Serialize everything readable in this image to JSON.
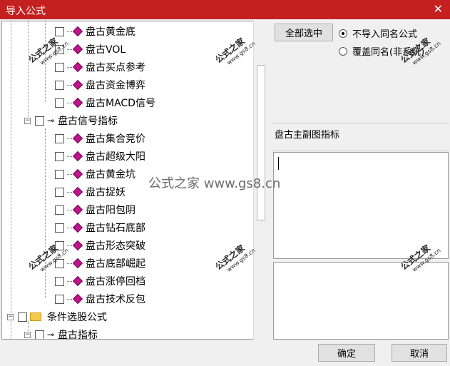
{
  "window": {
    "title": "导入公式"
  },
  "tree": {
    "items": [
      {
        "label": "盘古黄金底",
        "kind": "formula"
      },
      {
        "label": "盘古VOL",
        "kind": "formula"
      },
      {
        "label": "盘古买点参考",
        "kind": "formula"
      },
      {
        "label": "盘古资金博弈",
        "kind": "formula"
      },
      {
        "label": "盘古MACD信号",
        "kind": "formula"
      },
      {
        "label": "盘古信号指标",
        "kind": "group"
      },
      {
        "label": "盘古集合竞价",
        "kind": "formula"
      },
      {
        "label": "盘古超级大阳",
        "kind": "formula"
      },
      {
        "label": "盘古黄金坑",
        "kind": "formula"
      },
      {
        "label": "盘古捉妖",
        "kind": "formula"
      },
      {
        "label": "盘古阳包阴",
        "kind": "formula"
      },
      {
        "label": "盘古钻石底部",
        "kind": "formula"
      },
      {
        "label": "盘古形态突破",
        "kind": "formula"
      },
      {
        "label": "盘古底部崛起",
        "kind": "formula"
      },
      {
        "label": "盘古涨停回档",
        "kind": "formula"
      },
      {
        "label": "盘古技术反包",
        "kind": "formula"
      },
      {
        "label": "条件选股公式",
        "kind": "folder"
      },
      {
        "label": "盘古指标",
        "kind": "group"
      }
    ]
  },
  "options": {
    "select_all_label": "全部选中",
    "radio_no_import": "不导入同名公式",
    "radio_overwrite": "覆盖同名(非系统)"
  },
  "description": {
    "text": "盘古主副图指标"
  },
  "buttons": {
    "ok": "确定",
    "cancel": "取消"
  },
  "watermark": {
    "center": "公式之家 www.gs8.cn",
    "mark": "公式之家",
    "site": "www.gs8.cn"
  },
  "icons": {
    "close": "close-icon",
    "formula": "formula-gem-icon",
    "group": "key-icon",
    "folder": "folder-icon"
  }
}
